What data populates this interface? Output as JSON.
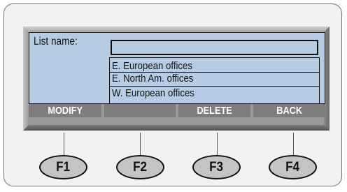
{
  "screen": {
    "list_name_label": "List name:",
    "list_name_value": "",
    "list_items": [
      "E. European offices",
      "E. North Am. offices",
      "W. European offices"
    ]
  },
  "softkeys": [
    "MODIFY",
    "",
    "DELETE",
    "BACK"
  ],
  "function_keys": [
    "F1",
    "F2",
    "F3",
    "F4"
  ],
  "colors": {
    "screen_bg": "#b7cbe5",
    "softkey_bg": "#7d7d7d",
    "bezel": "#9a9a9a",
    "key_bg": "#c4c4c4"
  }
}
